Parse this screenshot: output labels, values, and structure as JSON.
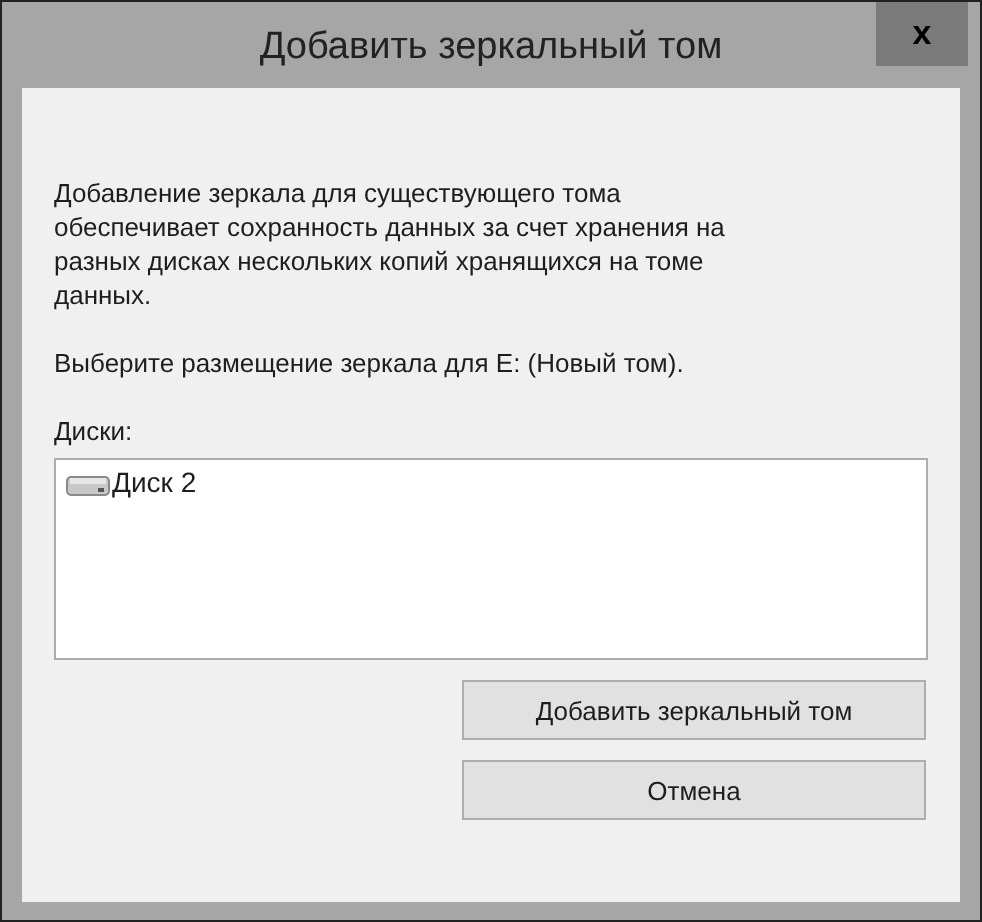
{
  "window": {
    "title": "Добавить зеркальный том",
    "close": "x"
  },
  "description": "Добавление зеркала для существующего тома обеспечивает сохранность данных за счет хранения на разных дисках нескольких копий хранящихся на томе данных.",
  "prompt": "Выберите размещение зеркала для E: (Новый том).",
  "disks": {
    "label": "Диски:",
    "items": [
      {
        "name": "Диск 2",
        "selected": false
      }
    ]
  },
  "buttons": [
    "Добавить зеркальный том",
    "Отмена"
  ]
}
